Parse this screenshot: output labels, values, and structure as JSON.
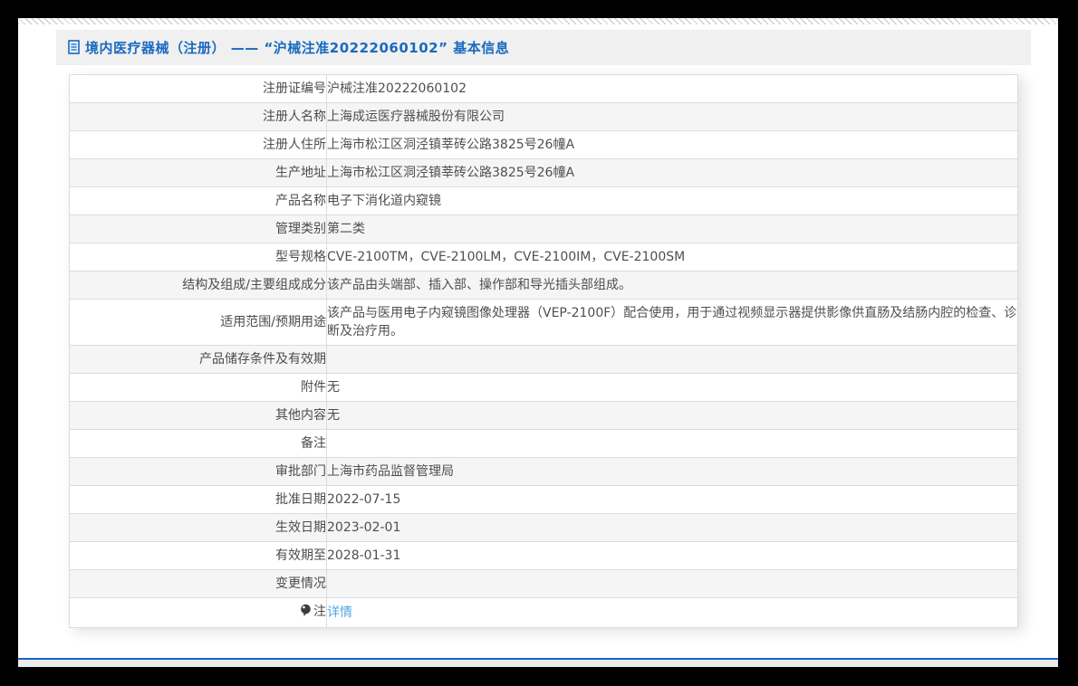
{
  "header": {
    "icon": "document-icon",
    "title": "境内医疗器械（注册） —— “沪械注准20222060102” 基本信息"
  },
  "table": {
    "rows": [
      {
        "label": "注册证编号",
        "value": "沪械注准20222060102"
      },
      {
        "label": "注册人名称",
        "value": "上海成运医疗器械股份有限公司"
      },
      {
        "label": "注册人住所",
        "value": "上海市松江区洞泾镇莘砖公路3825号26幢A"
      },
      {
        "label": "生产地址",
        "value": "上海市松江区洞泾镇莘砖公路3825号26幢A"
      },
      {
        "label": "产品名称",
        "value": "电子下消化道内窥镜"
      },
      {
        "label": "管理类别",
        "value": "第二类"
      },
      {
        "label": "型号规格",
        "value": "CVE-2100TM，CVE-2100LM，CVE-2100IM，CVE-2100SM"
      },
      {
        "label": "结构及组成/主要组成成分",
        "value": "该产品由头端部、插入部、操作部和导光插头部组成。"
      },
      {
        "label": "适用范围/预期用途",
        "value": "该产品与医用电子内窥镜图像处理器（VEP-2100F）配合使用，用于通过视频显示器提供影像供直肠及结肠内腔的检查、诊断及治疗用。"
      },
      {
        "label": "产品储存条件及有效期",
        "value": ""
      },
      {
        "label": "附件",
        "value": "无"
      },
      {
        "label": "其他内容",
        "value": "无"
      },
      {
        "label": "备注",
        "value": ""
      },
      {
        "label": "审批部门",
        "value": "上海市药品监督管理局"
      },
      {
        "label": "批准日期",
        "value": "2022-07-15"
      },
      {
        "label": "生效日期",
        "value": "2023-02-01"
      },
      {
        "label": "有效期至",
        "value": "2028-01-31"
      },
      {
        "label": "变更情况",
        "value": ""
      },
      {
        "label": "注",
        "value": "详情",
        "label_icon": "note-balloon-icon",
        "link": true
      }
    ]
  },
  "colors": {
    "title_blue": "#1a6abf",
    "link_blue": "#54a6e0",
    "footer_line_blue": "#1464c0",
    "row_alt_bg": "#f5f5f5",
    "border_gray": "#dcdcdc",
    "header_band_bg": "#f0f0f0",
    "frame_black": "#000000",
    "text_gray": "#4f4f4f"
  }
}
